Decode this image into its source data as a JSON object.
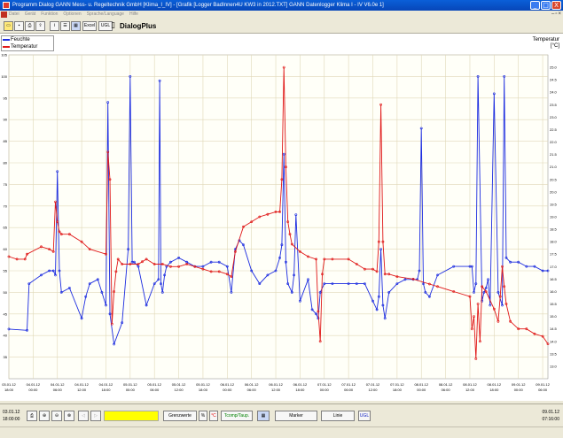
{
  "window": {
    "title": "Programm Dialog       GANN Mess- u. Regeltechnik GmbH [Klima_I_IV] - [Grafik [Logger BadInnen4U KW3 in 2012.TXT] GANN Datenlogger Klima I - IV V6.0e 1]",
    "min": "_",
    "max": "□",
    "close": "X"
  },
  "menu": {
    "items": [
      "Datei",
      "Gerät",
      "Funktion",
      "Optionen",
      "Sprache/Language",
      "Hilfe"
    ]
  },
  "toolbar": {
    "excel_label": "Excel",
    "ugl_label": "UGL",
    "app_title": "DialogPlus"
  },
  "legend": {
    "humidity_label": "Feuchte",
    "temperature_label": "Temperatur"
  },
  "right_axis": {
    "title_line1": "Temperatur",
    "title_line2": "[°C]"
  },
  "bottom": {
    "start_date": "03.01.12",
    "start_time": "18:00:00",
    "end_date": "09.01.12",
    "end_time": "07:16:00",
    "grenzwerte_label": "Grenzwerte",
    "percent_label": "%",
    "celsius_label": "°C",
    "tcomp_label": "Tcomp/Taup.",
    "marker_label": "Marker",
    "linie_label": "Linie",
    "ugl_label": "UGL"
  },
  "colors": {
    "humidity": "#1c2ce0",
    "temperature": "#e01818",
    "grid": "#e0d8b8"
  },
  "chart_data": {
    "type": "line",
    "title": "",
    "xlabel": "",
    "ylabel": "",
    "ylabel_right": "Temperatur [°C]",
    "grid": true,
    "legend": "top-left",
    "x_ticks": [
      {
        "date": "03.01.12",
        "time": "18:00"
      },
      {
        "date": "04.01.12",
        "time": "00:00"
      },
      {
        "date": "04.01.12",
        "time": "06:00"
      },
      {
        "date": "04.01.12",
        "time": "12:00"
      },
      {
        "date": "04.01.12",
        "time": "18:00"
      },
      {
        "date": "05.01.12",
        "time": "00:00"
      },
      {
        "date": "05.01.12",
        "time": "06:00"
      },
      {
        "date": "05.01.12",
        "time": "12:00"
      },
      {
        "date": "05.01.12",
        "time": "18:00"
      },
      {
        "date": "06.01.12",
        "time": "00:00"
      },
      {
        "date": "06.01.12",
        "time": "06:00"
      },
      {
        "date": "06.01.12",
        "time": "12:00"
      },
      {
        "date": "06.01.12",
        "time": "18:00"
      },
      {
        "date": "07.01.12",
        "time": "00:00"
      },
      {
        "date": "07.01.12",
        "time": "06:00"
      },
      {
        "date": "07.01.12",
        "time": "12:00"
      },
      {
        "date": "07.01.12",
        "time": "18:00"
      },
      {
        "date": "08.01.12",
        "time": "00:00"
      },
      {
        "date": "08.01.12",
        "time": "06:00"
      },
      {
        "date": "08.01.12",
        "time": "12:00"
      },
      {
        "date": "08.01.12",
        "time": "18:00"
      },
      {
        "date": "09.01.12",
        "time": "00:00"
      },
      {
        "date": "09.01.12",
        "time": "06:00"
      }
    ],
    "x_range_hours": [
      0,
      133.3
    ],
    "y_left": {
      "ylim": [
        30,
        105
      ],
      "ticks": [
        35,
        40,
        45,
        50,
        55,
        60,
        65,
        70,
        75,
        80,
        85,
        90,
        95,
        100,
        105
      ],
      "label": ""
    },
    "y_right": {
      "ylim": [
        12.5,
        25.5
      ],
      "ticks": [
        13.0,
        13.5,
        14.0,
        14.5,
        15.0,
        15.5,
        16.0,
        16.5,
        17.0,
        17.5,
        18.0,
        18.5,
        19.0,
        19.5,
        20.0,
        20.5,
        21.0,
        21.5,
        22.0,
        22.5,
        23.0,
        23.5,
        24.0,
        24.5,
        25.0
      ],
      "label": "Temperatur [°C]"
    },
    "series": [
      {
        "name": "Feuchte",
        "axis": "left",
        "color": "#1c2ce0",
        "x": [
          0,
          4.5,
          5,
          8,
          10,
          11,
          11.5,
          12,
          12.5,
          13,
          15,
          18,
          19,
          20,
          22,
          23,
          24,
          24.5,
          25,
          26,
          28,
          29.5,
          30,
          30.5,
          31,
          32,
          34,
          36,
          37,
          37.3,
          37.6,
          38,
          38.5,
          39,
          40,
          42,
          44,
          46,
          48,
          50,
          52,
          54,
          55,
          56,
          57,
          58,
          60,
          62,
          64,
          66,
          67,
          67.5,
          68,
          68.5,
          69,
          70,
          70.5,
          71,
          72,
          74,
          75,
          76,
          76.5,
          77,
          78,
          80,
          84,
          86,
          88,
          90,
          91,
          91.5,
          92,
          92.5,
          93,
          94,
          96,
          98,
          100,
          101,
          101.5,
          102,
          102.5,
          103,
          104,
          106,
          110,
          114,
          114.5,
          115,
          115.5,
          116,
          117,
          117.5,
          118,
          118.5,
          119,
          120,
          121,
          122,
          122.5,
          123,
          124,
          126,
          128,
          130,
          132,
          133.3
        ],
        "values": [
          41.5,
          41.2,
          52,
          54,
          55,
          55,
          54,
          78,
          55,
          50,
          51,
          44,
          49,
          52,
          53,
          50,
          47,
          94,
          45,
          38,
          43,
          60,
          100,
          57,
          57,
          56,
          47,
          52,
          53,
          99,
          52,
          50,
          54,
          56,
          57,
          58,
          57,
          56,
          56,
          57,
          57,
          56,
          50,
          60,
          62,
          61,
          55,
          52,
          54,
          55,
          58,
          61,
          82,
          57,
          52,
          50,
          54,
          68,
          48,
          53,
          46,
          45,
          44,
          50,
          52,
          52,
          52,
          52,
          52,
          48,
          46,
          49,
          60,
          47,
          44,
          50,
          52,
          53,
          53,
          53,
          55,
          88,
          52,
          50,
          49,
          54,
          56,
          56,
          56,
          50,
          52,
          100,
          48,
          50,
          51,
          53,
          47,
          96,
          50,
          47,
          100,
          58,
          57,
          57,
          56,
          56,
          55,
          55
        ]
      },
      {
        "name": "Temperatur",
        "axis": "right",
        "color": "#e01818",
        "x": [
          0,
          2,
          4,
          4.5,
          8,
          10,
          11,
          11.5,
          12,
          12.5,
          13,
          15,
          18,
          20,
          24,
          24.5,
          25,
          25.5,
          26,
          26.5,
          27,
          28,
          30,
          32,
          33,
          34,
          36,
          38,
          40,
          42,
          44,
          46,
          48,
          50,
          52,
          54,
          55,
          56,
          58,
          60,
          62,
          64,
          66,
          67,
          67.5,
          68,
          68.5,
          69,
          69.5,
          70,
          72,
          74,
          76,
          76.5,
          77,
          77.5,
          78,
          80,
          84,
          86,
          88,
          90,
          91,
          91.5,
          92,
          92.5,
          93,
          94,
          96,
          100,
          104,
          106,
          110,
          114,
          114.5,
          115,
          115.5,
          116,
          116.5,
          117,
          118,
          120,
          121,
          121.5,
          122,
          122.5,
          123,
          124,
          126,
          128,
          130,
          132,
          133.3
        ],
        "values": [
          17.4,
          17.3,
          17.3,
          17.5,
          17.8,
          17.7,
          17.6,
          19.6,
          18.8,
          18.4,
          18.3,
          18.3,
          18.0,
          17.7,
          17.5,
          21.6,
          20.5,
          14.7,
          16.0,
          16.8,
          17.3,
          17.1,
          17.1,
          17.1,
          17.2,
          17.3,
          17.1,
          17.1,
          17.0,
          17.0,
          17.1,
          17.0,
          16.9,
          16.8,
          16.8,
          16.7,
          16.6,
          17.6,
          18.6,
          18.8,
          19.0,
          19.1,
          19.2,
          19.2,
          20.5,
          25.0,
          21.0,
          18.8,
          18.3,
          17.9,
          17.6,
          17.4,
          17.3,
          15.2,
          14.0,
          16.7,
          17.3,
          17.3,
          17.3,
          17.1,
          16.9,
          16.9,
          16.8,
          18.0,
          23.5,
          18.0,
          16.7,
          16.7,
          16.6,
          16.5,
          16.3,
          16.2,
          16.0,
          15.8,
          14.5,
          15.0,
          13.3,
          15.5,
          14.0,
          16.2,
          16.0,
          15.3,
          14.8,
          15.8,
          17.0,
          16.2,
          15.5,
          14.8,
          14.5,
          14.5,
          14.3,
          14.2,
          13.9
        ]
      }
    ]
  }
}
